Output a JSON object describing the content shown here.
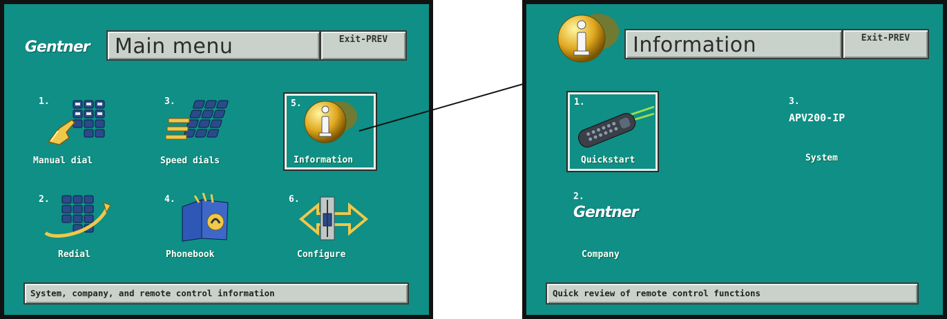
{
  "left_screen": {
    "logo": "Gentner",
    "title": "Main menu",
    "exit_label": "Exit-PREV",
    "items": [
      {
        "number": "1.",
        "label": "Manual dial",
        "icon": "keypad-hand-icon"
      },
      {
        "number": "3.",
        "label": "Speed dials",
        "icon": "speed-keypad-icon"
      },
      {
        "number": "5.",
        "label": "Information",
        "icon": "info-icon",
        "selected": true
      },
      {
        "number": "2.",
        "label": "Redial",
        "icon": "redial-keypad-icon"
      },
      {
        "number": "4.",
        "label": "Phonebook",
        "icon": "phonebook-icon"
      },
      {
        "number": "6.",
        "label": "Configure",
        "icon": "configure-slider-icon"
      }
    ],
    "status": "System, company, and remote control information"
  },
  "right_screen": {
    "title": "Information",
    "exit_label": "Exit-PREV",
    "items": [
      {
        "number": "1.",
        "label": "Quickstart",
        "icon": "remote-control-icon",
        "selected": true
      },
      {
        "number": "3.",
        "label": "System",
        "model": "APV200-IP"
      },
      {
        "number": "2.",
        "label": "Company",
        "logo": "Gentner"
      }
    ],
    "status": "Quick review of remote control functions"
  },
  "colors": {
    "screen_bg": "#0f8f86",
    "bar_bg": "#c9d2ca",
    "arrow": "#111111"
  }
}
